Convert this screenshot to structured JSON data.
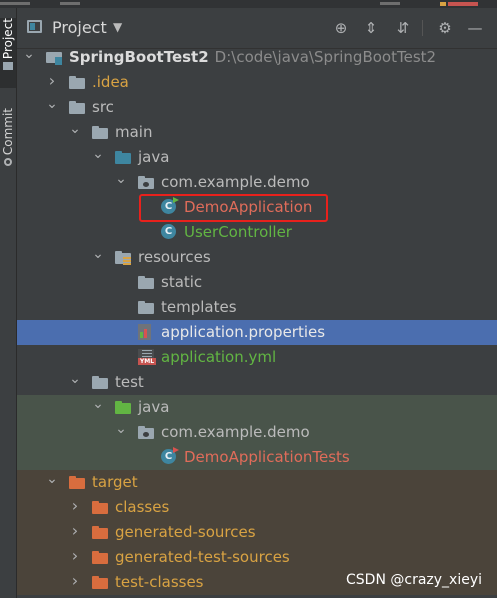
{
  "panel": {
    "title": "Project",
    "dropdown": "▼",
    "actions": [
      {
        "name": "locate-icon",
        "glyph": "⊕"
      },
      {
        "name": "expand-all-icon",
        "glyph": "⇕"
      },
      {
        "name": "collapse-all-icon",
        "glyph": "⇵"
      },
      {
        "name": "settings-icon",
        "glyph": "⚙"
      },
      {
        "name": "hide-icon",
        "glyph": "—"
      }
    ]
  },
  "side_tabs": {
    "project": "Project",
    "commit": "Commit"
  },
  "tree": [
    {
      "label": "SpringBootTest2",
      "path": "D:\\code\\java\\SpringBootTest2",
      "indent": 0,
      "arrow": "down",
      "icon": "module",
      "color": "#dcdcdc",
      "bold": true,
      "row": "normal"
    },
    {
      "label": ".idea",
      "indent": 1,
      "arrow": "right",
      "icon": "folder-gray",
      "color": "#d9a343",
      "row": "normal"
    },
    {
      "label": "src",
      "indent": 1,
      "arrow": "down",
      "icon": "folder-gray",
      "color": "#bbbbbb",
      "row": "normal"
    },
    {
      "label": "main",
      "indent": 2,
      "arrow": "down",
      "icon": "folder-gray",
      "color": "#bbbbbb",
      "row": "normal"
    },
    {
      "label": "java",
      "indent": 3,
      "arrow": "down",
      "icon": "folder-blue",
      "color": "#bbbbbb",
      "row": "normal"
    },
    {
      "label": "com.example.demo",
      "indent": 4,
      "arrow": "down",
      "icon": "package",
      "color": "#bbbbbb",
      "row": "normal"
    },
    {
      "label": "DemoApplication",
      "indent": 5,
      "arrow": "none",
      "icon": "class-run",
      "color": "#e06c5a",
      "row": "normal"
    },
    {
      "label": "UserController",
      "indent": 5,
      "arrow": "none",
      "icon": "class",
      "color": "#62b543",
      "row": "normal"
    },
    {
      "label": "resources",
      "indent": 3,
      "arrow": "down",
      "icon": "folder-res",
      "color": "#bbbbbb",
      "row": "normal"
    },
    {
      "label": "static",
      "indent": 4,
      "arrow": "none",
      "icon": "folder-gray",
      "color": "#bbbbbb",
      "row": "normal"
    },
    {
      "label": "templates",
      "indent": 4,
      "arrow": "none",
      "icon": "folder-gray",
      "color": "#bbbbbb",
      "row": "normal"
    },
    {
      "label": "application.properties",
      "indent": 4,
      "arrow": "none",
      "icon": "properties",
      "color": "#e8e8e8",
      "row": "selected"
    },
    {
      "label": "application.yml",
      "indent": 4,
      "arrow": "none",
      "icon": "yml",
      "color": "#62b543",
      "row": "normal"
    },
    {
      "label": "test",
      "indent": 2,
      "arrow": "down",
      "icon": "folder-gray",
      "color": "#bbbbbb",
      "row": "normal"
    },
    {
      "label": "java",
      "indent": 3,
      "arrow": "down",
      "icon": "folder-green",
      "color": "#bbbbbb",
      "row": "test"
    },
    {
      "label": "com.example.demo",
      "indent": 4,
      "arrow": "down",
      "icon": "package",
      "color": "#bbbbbb",
      "row": "test"
    },
    {
      "label": "DemoApplicationTests",
      "indent": 5,
      "arrow": "none",
      "icon": "class-runtest",
      "color": "#e06c5a",
      "row": "test"
    },
    {
      "label": "target",
      "indent": 1,
      "arrow": "down",
      "icon": "folder-orange",
      "color": "#d9a343",
      "row": "excluded"
    },
    {
      "label": "classes",
      "indent": 2,
      "arrow": "right",
      "icon": "folder-orange",
      "color": "#d9a343",
      "row": "excluded"
    },
    {
      "label": "generated-sources",
      "indent": 2,
      "arrow": "right",
      "icon": "folder-orange",
      "color": "#d9a343",
      "row": "excluded"
    },
    {
      "label": "generated-test-sources",
      "indent": 2,
      "arrow": "right",
      "icon": "folder-orange",
      "color": "#d9a343",
      "row": "excluded"
    },
    {
      "label": "test-classes",
      "indent": 2,
      "arrow": "right",
      "icon": "folder-orange",
      "color": "#d9a343",
      "row": "excluded"
    }
  ],
  "highlighted_item": "DemoApplication",
  "watermark": "CSDN @crazy_xieyi"
}
